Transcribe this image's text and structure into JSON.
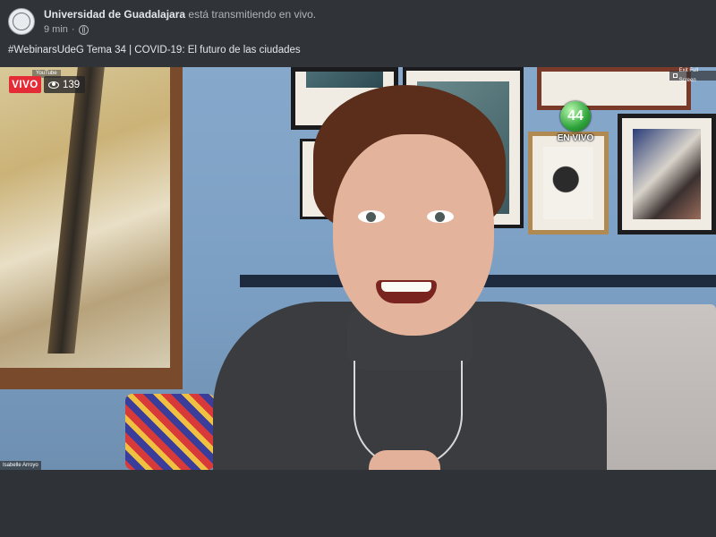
{
  "post": {
    "page_name": "Universidad de Guadalajara",
    "action_text": " está transmitiendo en vivo.",
    "time_ago": "9 min",
    "separator": "·",
    "title": "#WebinarsUdeG Tema 34 | COVID-19: El futuro de las ciudades"
  },
  "video": {
    "live_label": "VIVO",
    "viewer_count": "139",
    "meeting_top_text": "YouTube",
    "fullscreen_label": "Exit Full Screen",
    "channel_logo_number": "44",
    "channel_logo_label": "EN VIVO",
    "participant_name": "Isabelle Arroyo"
  },
  "colors": {
    "live_red": "#e42c37",
    "header_bg": "#303338",
    "logo_green": "#2ea43a"
  },
  "icons": {
    "avatar": "university-seal-icon",
    "privacy": "globe-icon",
    "viewers": "eye-icon",
    "fullscreen": "expand-icon"
  }
}
